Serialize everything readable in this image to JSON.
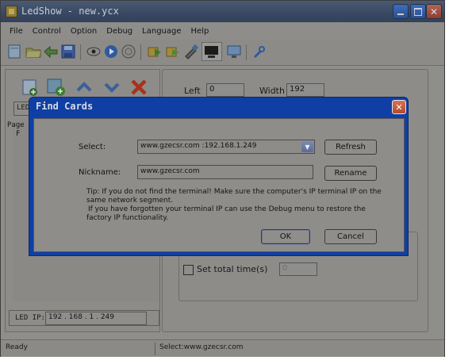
{
  "window": {
    "title": "LedShow - new.ycx"
  },
  "menu": [
    "File",
    "Control",
    "Option",
    "Debug",
    "Language",
    "Help"
  ],
  "toolbar_icons": [
    "new-file",
    "open-folder",
    "save",
    "separator",
    "preview-eye",
    "play",
    "stop",
    "separator",
    "send",
    "send-all",
    "usb-drive",
    "monitor",
    "screen",
    "separator",
    "wrench"
  ],
  "left_panel": {
    "tab_label": "LED",
    "tree_root": "Page",
    "tree_child": "F",
    "led_ip_label": "LED IP:",
    "led_ip_value": "192 . 168 . 1 . 249"
  },
  "right_panel": {
    "left_label": "Left",
    "left_value": "0",
    "width_label": "Width",
    "width_value": "192",
    "total_time_label": "Set total time(s)",
    "total_time_value": "0"
  },
  "status": {
    "left": "Ready",
    "right": "Select:www.gzecsr.com"
  },
  "dialog": {
    "title": "Find Cards",
    "close_glyph": "✕",
    "select_label": "Select:",
    "select_value": "www.gzecsr.com :192.168.1.249",
    "refresh_label": "Refresh",
    "nickname_label": "Nickname:",
    "nickname_value": "www.gzecsr.com",
    "rename_label": "Rename",
    "tip_line1": "Tip: If you do not find the terminal! Make sure the computer's IP terminal IP on the",
    "tip_line2": "same network segment.",
    "tip_line3": "If you have forgotten your terminal IP can use the Debug menu to restore the",
    "tip_line4": "factory IP functionality.",
    "ok_label": "OK",
    "cancel_label": "Cancel"
  },
  "colors": {
    "dialog_frame": "#0f3fa4",
    "titlebar": "#394862",
    "dim_surface": "#8e8d8a",
    "close_red": "#c2573a"
  }
}
